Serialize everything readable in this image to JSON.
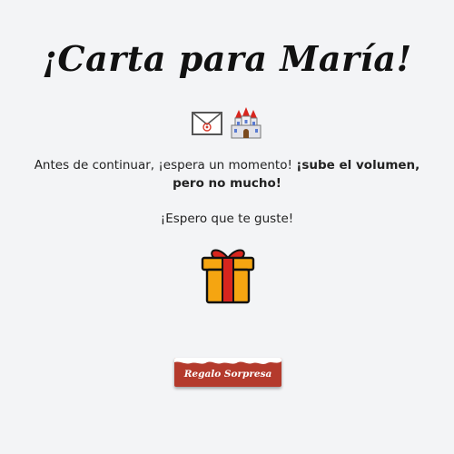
{
  "header": {
    "title": "¡Carta para María!"
  },
  "icons": {
    "envelope": "envelope-icon",
    "castle": "castle-icon",
    "gift": "gift-icon"
  },
  "message": {
    "intro_plain": "Antes de continuar, ¡espera un momento! ",
    "intro_bold": "¡sube el volumen, pero no mucho!",
    "hope": "¡Espero que te guste!"
  },
  "button": {
    "label": "Regalo Sorpresa"
  },
  "colors": {
    "background": "#f3f4f6",
    "button": "#b43a2c",
    "gift_box": "#f5a511",
    "gift_ribbon": "#d8251e"
  }
}
